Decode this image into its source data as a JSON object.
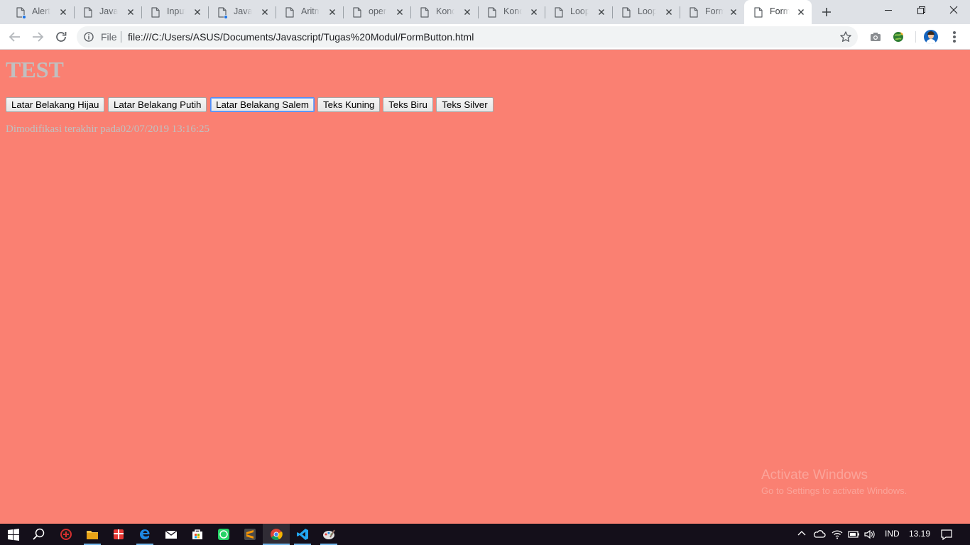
{
  "browser": {
    "tabs": [
      {
        "title": "Alert Box",
        "loading_dot": true
      },
      {
        "title": "JavaScript",
        "loading_dot": false
      },
      {
        "title": "Input Data",
        "loading_dot": false
      },
      {
        "title": "JavaScript",
        "loading_dot": true
      },
      {
        "title": "Aritmatika",
        "loading_dot": false
      },
      {
        "title": "operator",
        "loading_dot": false
      },
      {
        "title": "Kondisi",
        "loading_dot": false
      },
      {
        "title": "Kondisi",
        "loading_dot": false
      },
      {
        "title": "Looping",
        "loading_dot": false
      },
      {
        "title": "Looping",
        "loading_dot": false
      },
      {
        "title": "Form",
        "loading_dot": false
      },
      {
        "title": "Form",
        "loading_dot": false,
        "active": true
      }
    ],
    "address": {
      "scheme_label": "File",
      "url": "file:///C:/Users/ASUS/Documents/Javascript/Tugas%20Modul/FormButton.html"
    }
  },
  "page": {
    "background": "#fa8072",
    "text_color": "#c0c0c0",
    "heading": "TEST",
    "buttons": [
      {
        "label": "Latar Belakang Hijau"
      },
      {
        "label": "Latar Belakang Putih"
      },
      {
        "label": "Latar Belakang Salem",
        "focused": true
      },
      {
        "label": "Teks Kuning"
      },
      {
        "label": "Teks Biru"
      },
      {
        "label": "Teks Silver"
      }
    ],
    "last_modified": "Dimodifikasi terakhir pada02/07/2019 13:16:25"
  },
  "watermark": {
    "line1": "Activate Windows",
    "line2": "Go to Settings to activate Windows."
  },
  "taskbar": {
    "apps": [
      "windows-start",
      "search",
      "game-app",
      "file-explorer",
      "gift-app",
      "edge",
      "mail",
      "store",
      "whatsapp",
      "sublime-text",
      "chrome",
      "vscode",
      "paint-app"
    ],
    "tray": {
      "language": "IND",
      "time": "13.19"
    }
  }
}
